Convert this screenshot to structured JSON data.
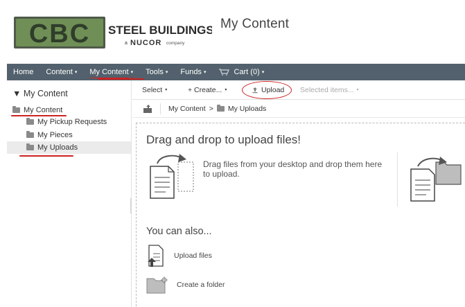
{
  "header": {
    "logo": {
      "mark": "CBC",
      "line1": "STEEL BUILDINGS",
      "line2_prefix": "a",
      "line2_brand": "NUCOR",
      "line2_suffix": "company"
    },
    "page_title": "My Content"
  },
  "nav": {
    "items": [
      {
        "label": "Home",
        "has_caret": false
      },
      {
        "label": "Content",
        "has_caret": true
      },
      {
        "label": "My Content",
        "has_caret": true
      },
      {
        "label": "Tools",
        "has_caret": true
      },
      {
        "label": "Funds",
        "has_caret": true
      },
      {
        "label": "Cart (0)",
        "has_caret": true,
        "icon": "cart-icon"
      }
    ],
    "caret": "▾"
  },
  "sidebar": {
    "title": "▼ My Content",
    "root": "My Content",
    "children": [
      "My Pickup Requests",
      "My Pieces",
      "My Uploads"
    ]
  },
  "toolbar": {
    "select": "Select",
    "create": "+ Create...",
    "upload": "Upload",
    "selected_items": "Selected items...",
    "caret": "▾"
  },
  "breadcrumb": {
    "root": "My Content",
    "separator": ">",
    "current": "My Uploads"
  },
  "droparea": {
    "title": "Drag and drop to upload files!",
    "instructions": "Drag files from your desktop and drop them here to upload.",
    "also_title": "You can also...",
    "upload_files": "Upload files",
    "create_folder": "Create a folder"
  },
  "colors": {
    "nav_bg": "#52616d",
    "logo_green": "#4a6b3a",
    "annotation_red": "#cc2222",
    "selected_row": "#ebebeb"
  }
}
